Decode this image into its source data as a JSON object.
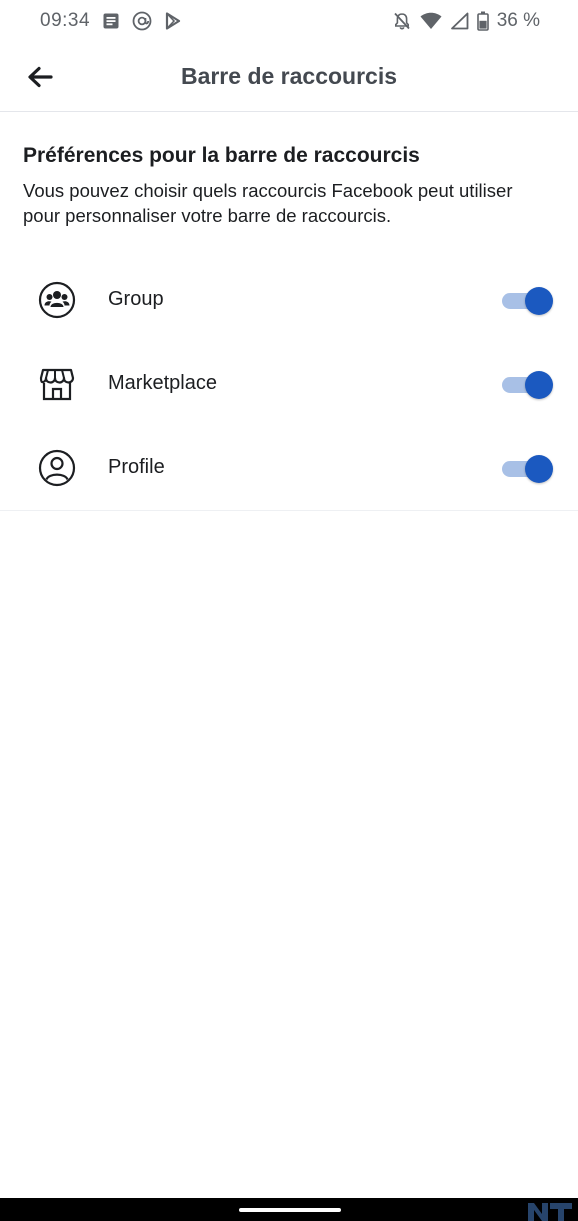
{
  "status_bar": {
    "time": "09:34",
    "battery": "36 %"
  },
  "header": {
    "title": "Barre de raccourcis"
  },
  "preferences": {
    "title": "Préférences pour la barre de raccourcis",
    "description": "Vous pouvez choisir quels raccourcis Facebook peut utiliser pour personnaliser votre barre de raccourcis."
  },
  "shortcuts": [
    {
      "label": "Group",
      "icon": "group-icon",
      "enabled": true
    },
    {
      "label": "Marketplace",
      "icon": "marketplace-icon",
      "enabled": true
    },
    {
      "label": "Profile",
      "icon": "profile-icon",
      "enabled": true
    }
  ],
  "colors": {
    "toggle_on": "#1b59c0",
    "toggle_track_on": "#a8c0e6"
  }
}
